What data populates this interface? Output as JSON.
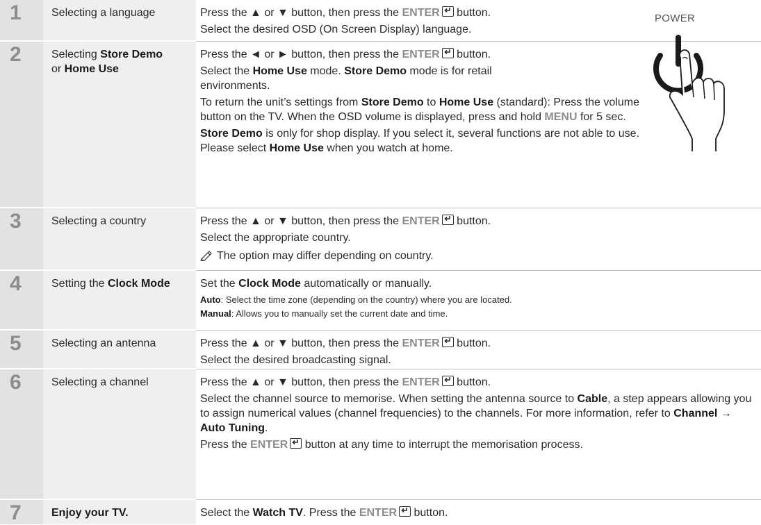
{
  "steps": [
    {
      "number": "1",
      "title": "Selecting a language",
      "lines": [
        {
          "text": "Press the ▲ or ▼ button, then press the ",
          "kw": "ENTER",
          "after": " button."
        },
        {
          "text": "Select the desired OSD (On Screen Display) language."
        }
      ]
    },
    {
      "number": "2",
      "title_a": "Selecting ",
      "title_b": "Store Demo",
      "title_c": "or ",
      "title_d": "Home Use",
      "l1": {
        "text": "Press the ◄ or ► button, then press the ",
        "kw": "ENTER",
        "after": " button."
      },
      "l2a": "Select the ",
      "l2b": "Home Use",
      "l2c": " mode. ",
      "l2d": "Store Demo",
      "l2e": " mode is for retail environments.",
      "l3a": "To return the unit’s settings from ",
      "l3b": "Store Demo",
      "l3c": " to ",
      "l3d": "Home Use",
      "l3e": " (standard): Press the volume button on the TV. When the OSD volume is displayed, press and hold ",
      "l3f": "MENU",
      "l3g": " for 5 sec.",
      "l4a": "Store Demo",
      "l4b": " is only for shop display. If you select it, several functions are not able to use. Please select ",
      "l4c": "Home Use",
      "l4d": " when you watch at home."
    },
    {
      "number": "3",
      "title": "Selecting a country",
      "l1": {
        "text": "Press the ▲ or ▼ button, then press the ",
        "kw": "ENTER",
        "after": " button."
      },
      "l2": "Select the appropriate country.",
      "note": "The option may differ depending on country."
    },
    {
      "number": "4",
      "title_a": "Setting the ",
      "title_b": "Clock Mode",
      "l1a": "Set the ",
      "l1b": "Clock Mode",
      "l1c": " automatically or manually.",
      "l2a": "Auto",
      "l2b": ": Select the time zone (depending on the country) where you are located.",
      "l3a": "Manual",
      "l3b": ": Allows you to manually set the current date and time."
    },
    {
      "number": "5",
      "title": "Selecting an antenna",
      "l1": {
        "text": "Press the ▲ or ▼ button, then press the ",
        "kw": "ENTER",
        "after": " button."
      },
      "l2": "Select the desired broadcasting signal."
    },
    {
      "number": "6",
      "title": "Selecting a channel",
      "l1": {
        "text": "Press the ▲ or ▼ button, then press the ",
        "kw": "ENTER",
        "after": " button."
      },
      "l2a": "Select the channel source to memorise. When setting the antenna source to ",
      "l2b": "Cable",
      "l2c": ", a step appears allowing you to assign numerical values (channel frequencies) to the channels. For more information, refer to ",
      "l2d": "Channel",
      "l2e": " → ",
      "l2f": "Auto Tuning",
      "l2g": ".",
      "l3a": "Press the ",
      "l3b": "ENTER",
      "l3c": " button at any time to interrupt the memorisation process."
    },
    {
      "number": "7",
      "title": "Enjoy your TV.",
      "l1a": "Select the ",
      "l1b": "Watch TV",
      "l1c": ". Press the ",
      "l1d": "ENTER",
      "l1e": " button."
    }
  ],
  "power_label": "POWER",
  "icons": {
    "enter": "enter-key-icon",
    "note": "note-pencil-icon",
    "power": "power-button-hand-icon"
  }
}
